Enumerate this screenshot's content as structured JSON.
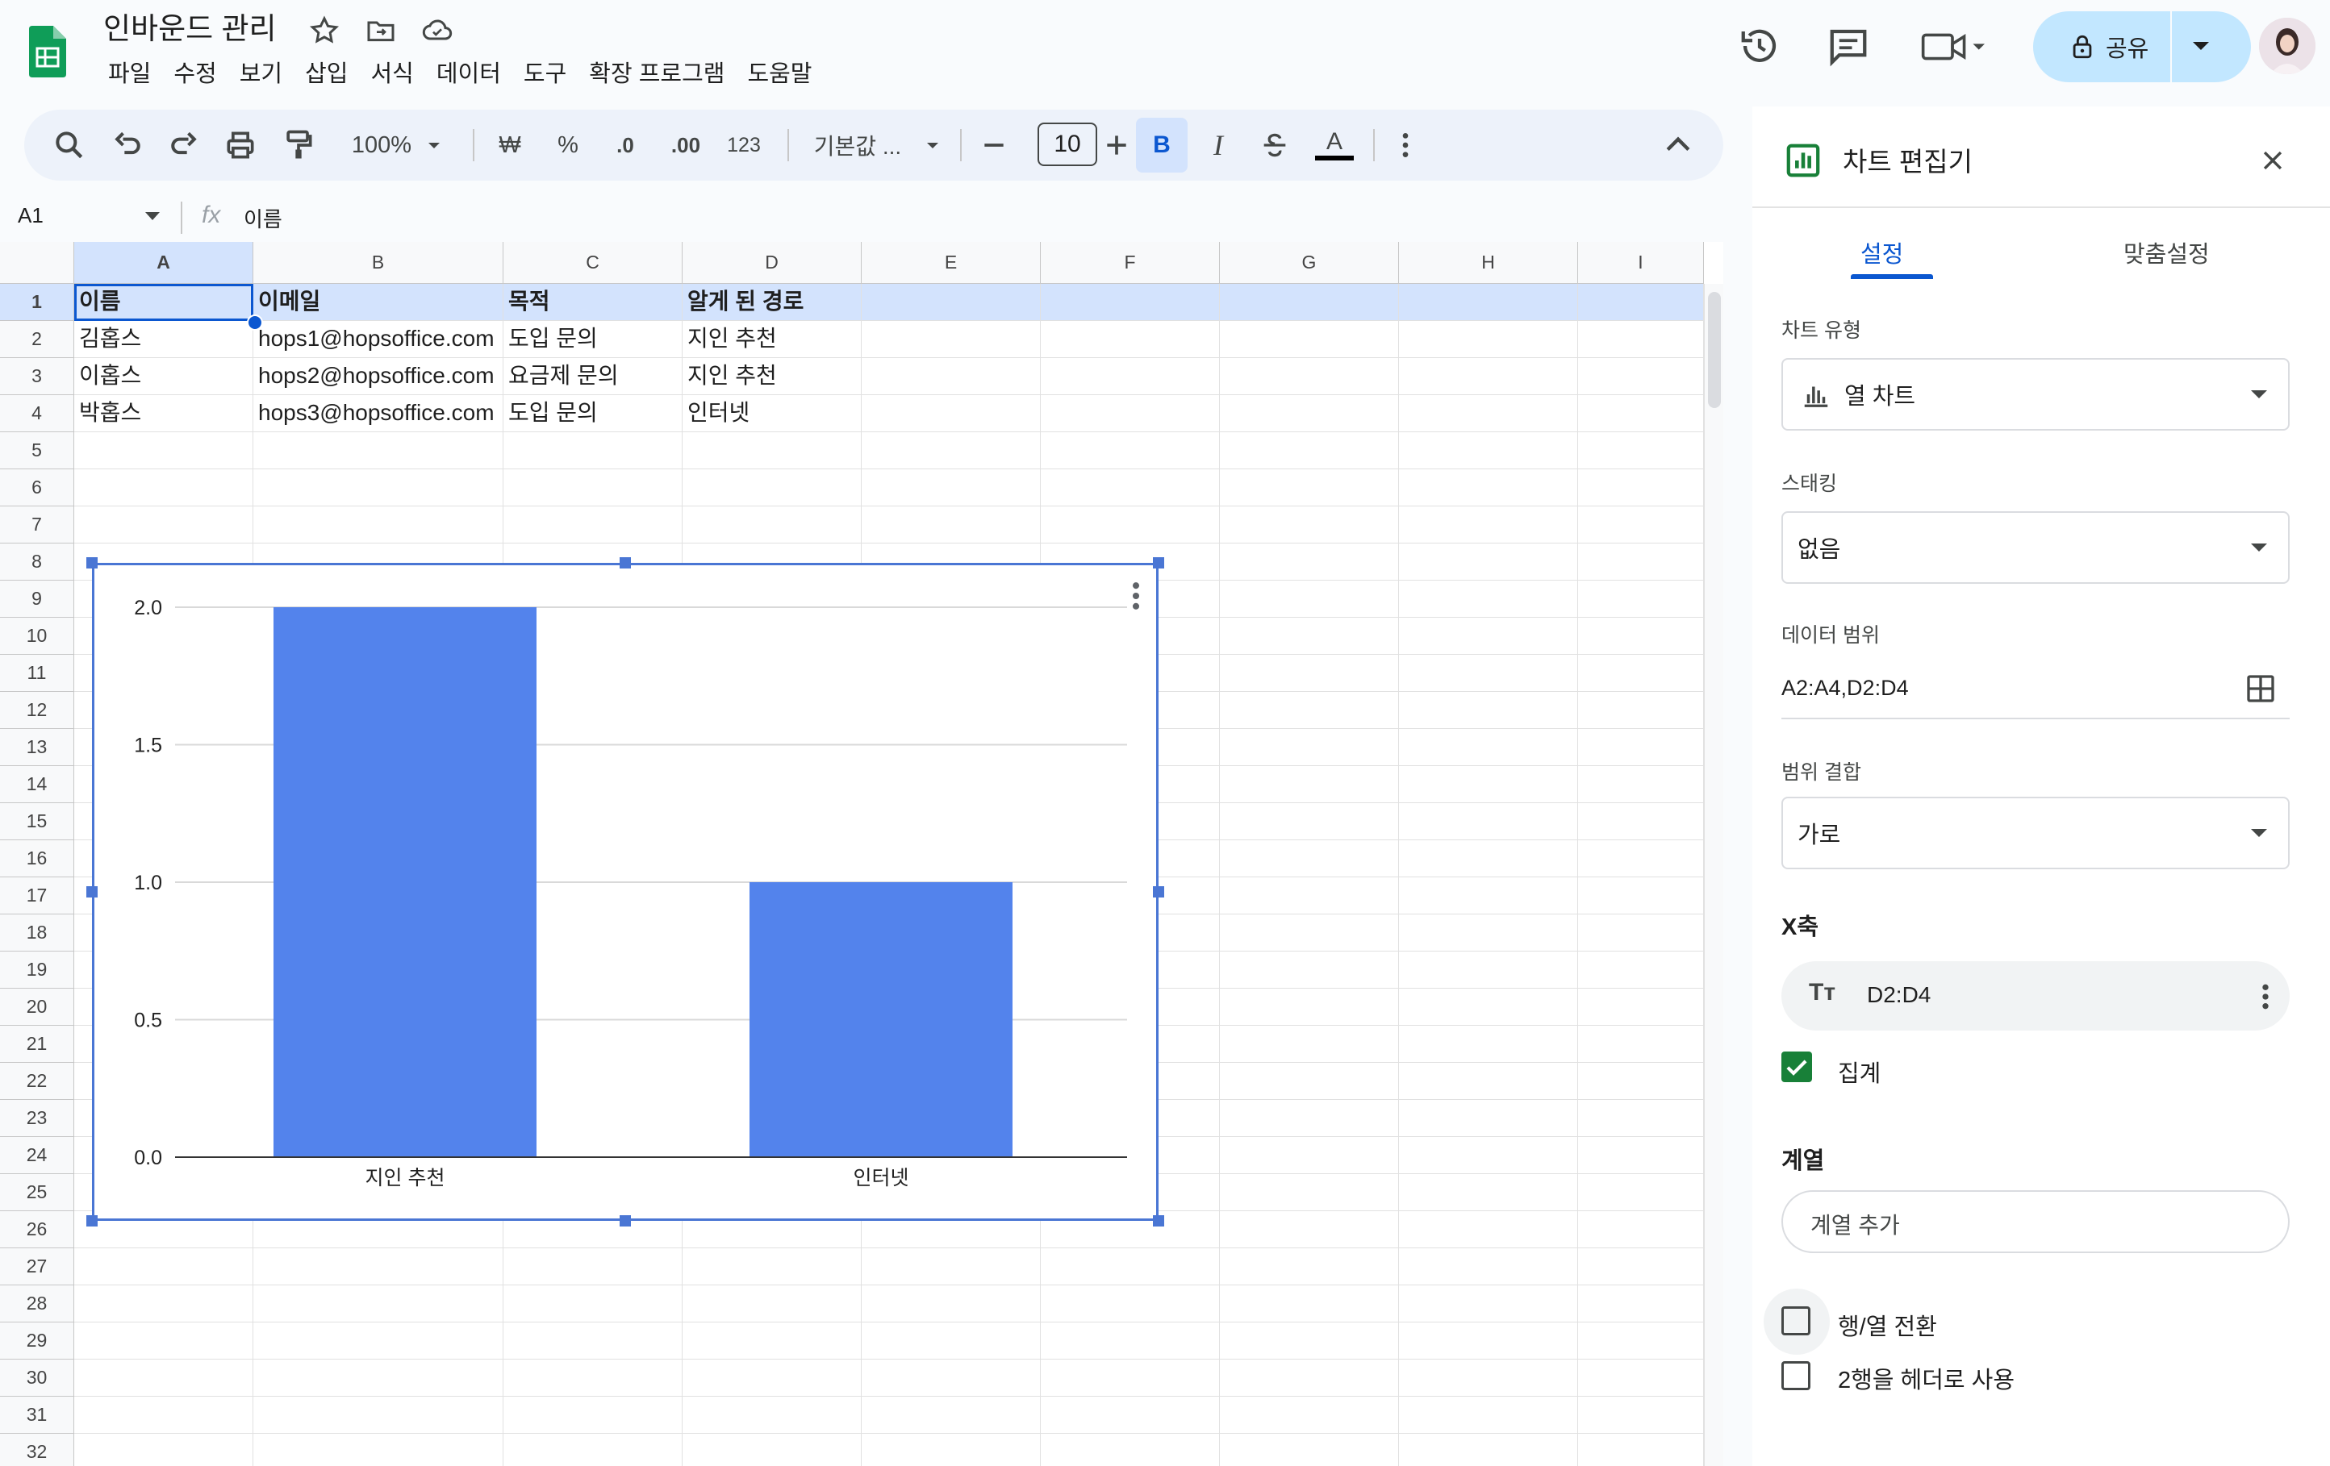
{
  "header": {
    "title": "인바운드 관리",
    "menus": [
      "파일",
      "수정",
      "보기",
      "삽입",
      "서식",
      "데이터",
      "도구",
      "확장 프로그램",
      "도움말"
    ],
    "share_label": "공유"
  },
  "toolbar": {
    "zoom": "100%",
    "currency": "₩",
    "percent": "%",
    "dec_decrease": ".0",
    "dec_increase": ".00",
    "number_format": "123",
    "font": "기본값 ...",
    "font_size": "10",
    "bold": "B",
    "italic": "I",
    "text_color": "A"
  },
  "formula_bar": {
    "cell_ref": "A1",
    "fx": "fx",
    "value": "이름"
  },
  "sheet": {
    "columns": [
      "A",
      "B",
      "C",
      "D",
      "E",
      "F",
      "G",
      "H",
      "I"
    ],
    "rows": [
      "1",
      "2",
      "3",
      "4",
      "5",
      "6",
      "7",
      "8",
      "9",
      "10",
      "11",
      "12",
      "13",
      "14",
      "15",
      "16",
      "17",
      "18",
      "19",
      "20",
      "21",
      "22",
      "23",
      "24",
      "25",
      "26",
      "27",
      "28",
      "29",
      "30",
      "31",
      "32"
    ],
    "data": [
      [
        "이름",
        "이메일",
        "목적",
        "알게 된 경로"
      ],
      [
        "김홉스",
        "hops1@hopsoffice.com",
        "도입 문의",
        "지인 추천"
      ],
      [
        "이홉스",
        "hops2@hopsoffice.com",
        "요금제 문의",
        "지인 추천"
      ],
      [
        "박홉스",
        "hops3@hopsoffice.com",
        "도입 문의",
        "인터넷"
      ]
    ]
  },
  "chart_data": {
    "type": "bar",
    "categories": [
      "지인 추천",
      "인터넷"
    ],
    "values": [
      2,
      1
    ],
    "ylim": [
      0,
      2
    ],
    "yticks": [
      "0.0",
      "0.5",
      "1.0",
      "1.5",
      "2.0"
    ],
    "title": "",
    "xlabel": "",
    "ylabel": "",
    "grid": true,
    "bar_color": "#5383ec"
  },
  "side_panel": {
    "title": "차트 편집기",
    "tabs": [
      "설정",
      "맞춤설정"
    ],
    "chart_type_label": "차트 유형",
    "chart_type_value": "열 차트",
    "stacking_label": "스태킹",
    "stacking_value": "없음",
    "data_range_label": "데이터 범위",
    "data_range_value": "A2:A4,D2:D4",
    "combine_label": "범위 결합",
    "combine_value": "가로",
    "x_axis_label": "X축",
    "x_axis_value": "D2:D4",
    "aggregate_label": "집계",
    "series_label": "계열",
    "add_series": "계열 추가",
    "switch_rows_cols": "행/열 전환",
    "use_row2_header": "2행을 헤더로 사용"
  },
  "colors": {
    "accent": "#0b57d0",
    "sheets_green": "#188038",
    "selection_blue": "#4a76d4",
    "share_bg": "#c2e7ff"
  }
}
